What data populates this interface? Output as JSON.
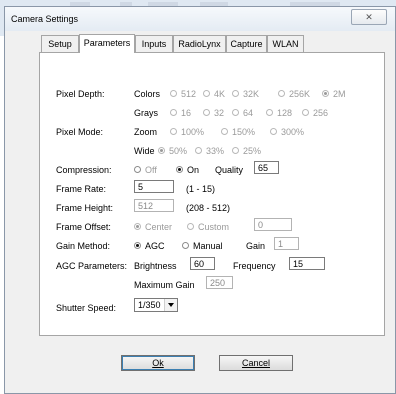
{
  "window": {
    "title": "Camera Settings",
    "close_glyph": "✕"
  },
  "tabs": [
    {
      "label": "Setup",
      "active": false
    },
    {
      "label": "Parameters",
      "active": true
    },
    {
      "label": "Inputs",
      "active": false
    },
    {
      "label": "RadioLynx",
      "active": false
    },
    {
      "label": "Capture",
      "active": false
    },
    {
      "label": "WLAN",
      "active": false
    }
  ],
  "labels": {
    "pixel_depth": "Pixel Depth:",
    "pixel_mode": "Pixel Mode:",
    "compression": "Compression:",
    "frame_rate": "Frame Rate:",
    "frame_height": "Frame Height:",
    "frame_offset": "Frame Offset:",
    "gain_method": "Gain Method:",
    "agc_parameters": "AGC Parameters:",
    "shutter_speed": "Shutter Speed:"
  },
  "pixel_depth": {
    "colors_label": "Colors",
    "colors_options": [
      "512",
      "4K",
      "32K",
      "256K",
      "2M"
    ],
    "colors_selected": "2M",
    "grays_label": "Grays",
    "grays_options": [
      "16",
      "32",
      "64",
      "128",
      "256"
    ]
  },
  "pixel_mode": {
    "zoom_label": "Zoom",
    "zoom_options": [
      "100%",
      "150%",
      "300%"
    ],
    "wide_label": "Wide",
    "wide_options": [
      "50%",
      "33%",
      "25%"
    ],
    "wide_selected": "50%"
  },
  "compression": {
    "off_label": "Off",
    "on_label": "On",
    "selected": "On",
    "quality_label": "Quality",
    "quality_value": "65"
  },
  "frame_rate": {
    "value": "5",
    "range": "(1 - 15)"
  },
  "frame_height": {
    "value": "512",
    "range": "(208 - 512)"
  },
  "frame_offset": {
    "center_label": "Center",
    "custom_label": "Custom",
    "selected": "Center",
    "value": "0"
  },
  "gain_method": {
    "agc_label": "AGC",
    "manual_label": "Manual",
    "selected": "AGC",
    "gain_label": "Gain",
    "gain_value": "1"
  },
  "agc": {
    "brightness_label": "Brightness",
    "brightness_value": "60",
    "frequency_label": "Frequency",
    "frequency_value": "15",
    "max_gain_label": "Maximum Gain",
    "max_gain_value": "250"
  },
  "shutter_speed": {
    "value": "1/350"
  },
  "buttons": {
    "ok_label": "Ok",
    "cancel_label": "Cancel"
  }
}
